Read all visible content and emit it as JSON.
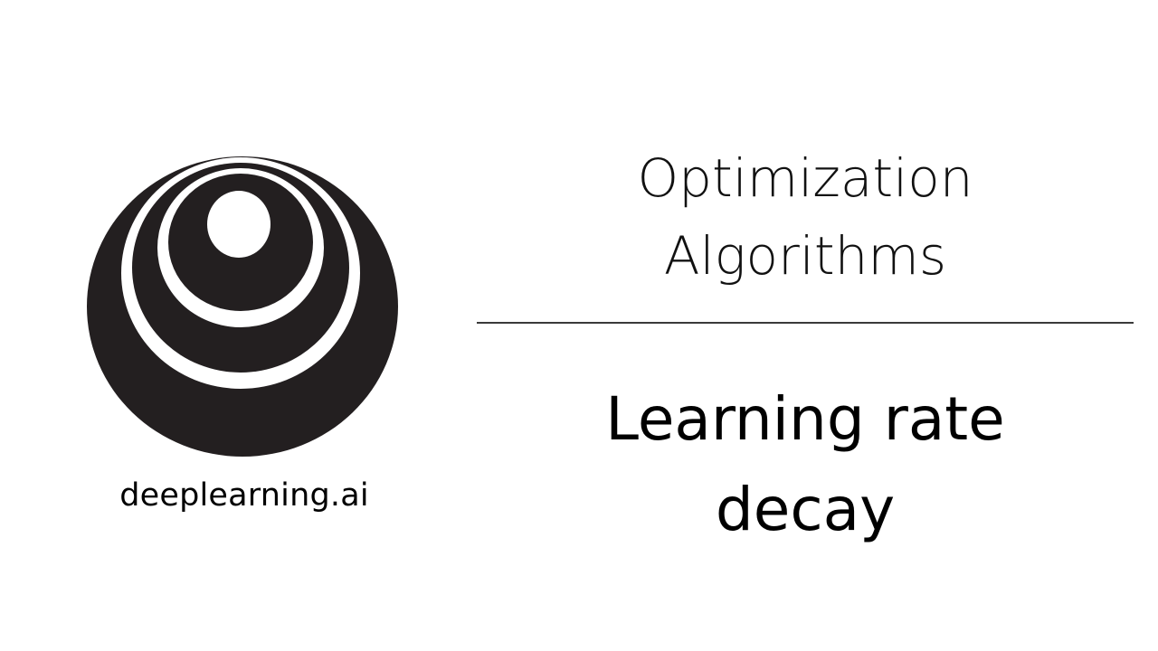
{
  "logo": {
    "icon": "deeplearning-ai-logo",
    "color": "#231f20",
    "background": "#ffffff"
  },
  "brand": {
    "name": "deeplearning.ai"
  },
  "section": {
    "title_line1": "Optimization",
    "title_line2": "Algorithms"
  },
  "video": {
    "title_line1": "Learning rate",
    "title_line2": "decay"
  }
}
